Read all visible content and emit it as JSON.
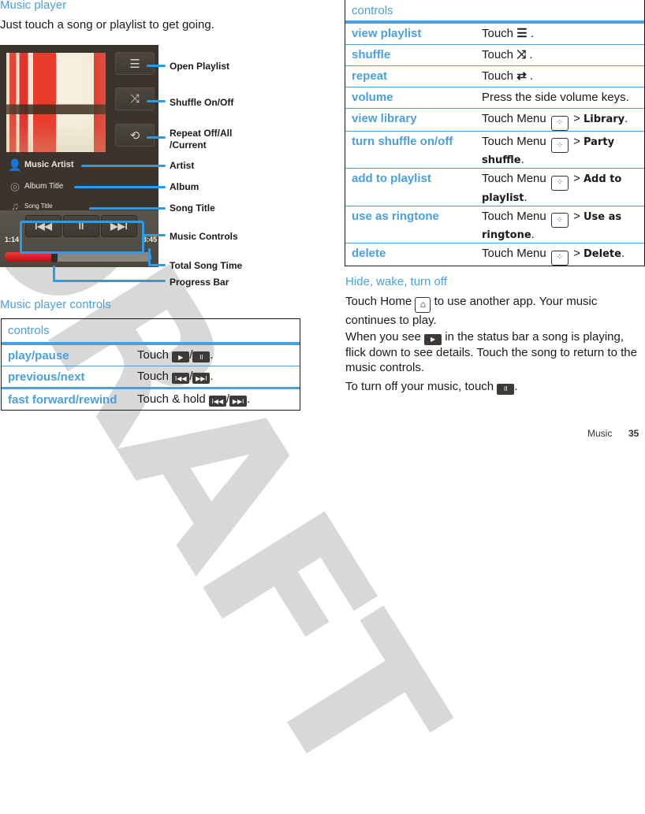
{
  "watermark": "DRAFT",
  "left": {
    "section_title": "Music player",
    "intro": "Just touch a song or playlist to get going.",
    "player": {
      "artist": "Music Artist",
      "album": "Album Title",
      "song": "Song Title",
      "elapsed": "1:14",
      "total": "3:45",
      "progress_fraction": 0.33,
      "icons": {
        "playlist": "☰",
        "shuffle": "⤨",
        "repeat": "⟲",
        "prev": "I◀◀",
        "pause": "II",
        "next": "▶▶I",
        "artist": "👤",
        "album": "◎",
        "song": "♫"
      }
    },
    "callouts": {
      "open_playlist": "Open Playlist",
      "shuffle": "Shuffle On/Off",
      "repeat_line1": "Repeat Off/All",
      "repeat_line2": "/Current",
      "artist": "Artist",
      "album": "Album",
      "song_title": "Song Title",
      "music_controls": "Music Controls",
      "total_song_time": "Total Song Time",
      "progress_bar": "Progress Bar"
    },
    "controls_title": "Music player controls",
    "controls_table": {
      "header": "controls",
      "rows": [
        {
          "action": "play/pause",
          "text": "Touch",
          "icon_a": "▶",
          "icon_b": "II",
          "suffix": "."
        },
        {
          "action": "previous/next",
          "text": "Touch",
          "icon_a": "I◀◀",
          "icon_b": "▶▶I",
          "suffix": "."
        },
        {
          "action": "fast forward/rewind",
          "text": "Touch & hold",
          "icon_a": "I◀◀",
          "icon_b": "▶▶I",
          "suffix": "."
        }
      ]
    }
  },
  "right": {
    "table": {
      "header": "controls",
      "rows": [
        {
          "action": "view playlist",
          "pre": "Touch",
          "icon": "☰",
          "post": "."
        },
        {
          "action": "shuffle",
          "pre": "Touch",
          "icon": "⤨",
          "post": "."
        },
        {
          "action": "repeat",
          "pre": "Touch",
          "icon": "⇄",
          "post": "."
        },
        {
          "action": "volume",
          "pre": "Press the side volume keys."
        },
        {
          "action": "view library",
          "pre": "Touch Menu",
          "menu_icon": "⁘",
          "gt": ">",
          "bold": "Library",
          "post": "."
        },
        {
          "action": "turn shuffle on/off",
          "pre": "Touch Menu",
          "menu_icon": "⁘",
          "gt": ">",
          "bold": "Party shuffle",
          "post": "."
        },
        {
          "action": "add to playlist",
          "pre": "Touch Menu",
          "menu_icon": "⁘",
          "gt": ">",
          "bold": "Add to playlist",
          "post": "."
        },
        {
          "action": "use as ringtone",
          "pre": "Touch Menu",
          "menu_icon": "⁘",
          "gt": ">",
          "bold": "Use as ringtone",
          "post": "."
        },
        {
          "action": "delete",
          "pre": "Touch Menu",
          "menu_icon": "⁘",
          "gt": ">",
          "bold": "Delete",
          "post": "."
        }
      ]
    },
    "hide_title": "Hide, wake, turn off",
    "para1_pre": "Touch Home",
    "para1_icon": "⌂",
    "para1_post": "to use another app. Your music continues to play.",
    "para2_pre": "When you see",
    "para2_icon": "▶",
    "para2_post": "in the status bar a song is playing, flick down to see details. Touch the song to return to the music controls.",
    "para3_pre": "To turn off your music, touch",
    "para3_icon": "II",
    "para3_post": "."
  },
  "footer": {
    "section": "Music",
    "page": "35"
  }
}
